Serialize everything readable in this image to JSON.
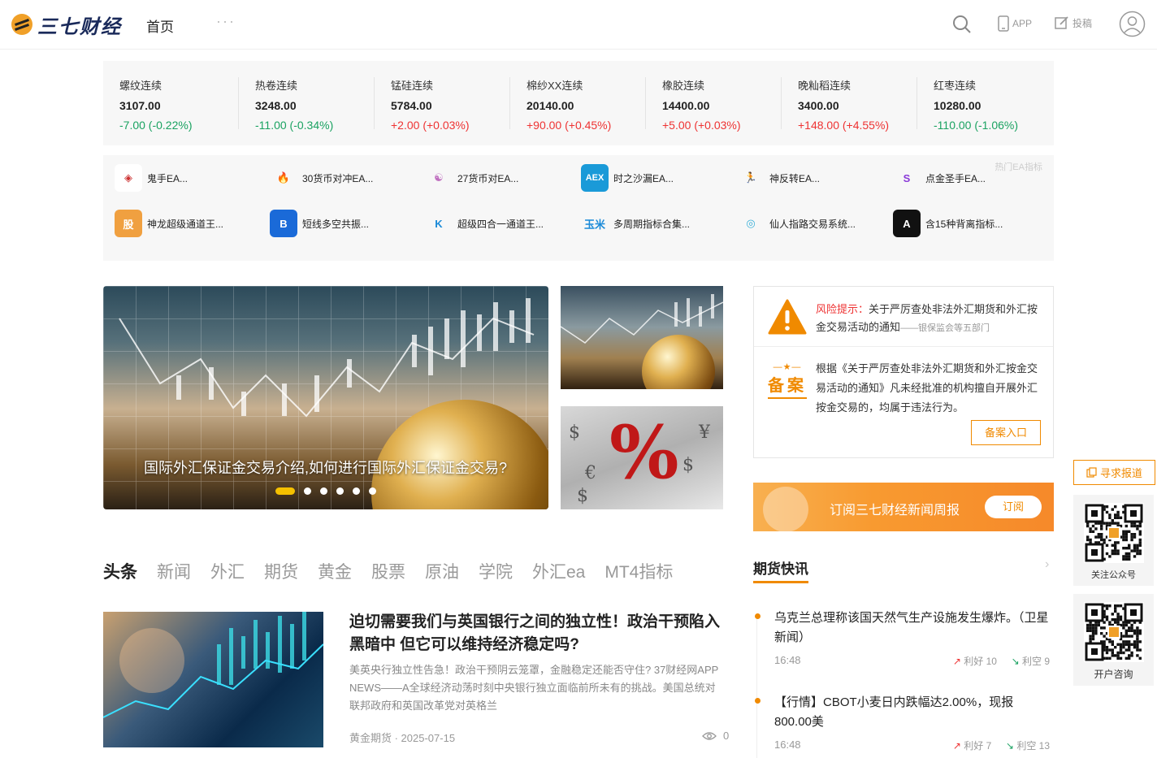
{
  "header": {
    "logo_text": "三七财经",
    "nav_home": "首页",
    "nav_more": "···",
    "app_label": "APP",
    "post_label": "投稿"
  },
  "quotes": [
    {
      "name": "螺纹连续",
      "price": "3107.00",
      "change": "-7.00 (-0.22%)",
      "dir": "down"
    },
    {
      "name": "热卷连续",
      "price": "3248.00",
      "change": "-11.00 (-0.34%)",
      "dir": "down"
    },
    {
      "name": "锰硅连续",
      "price": "5784.00",
      "change": "+2.00 (+0.03%)",
      "dir": "up"
    },
    {
      "name": "棉纱XX连续",
      "price": "20140.00",
      "change": "+90.00 (+0.45%)",
      "dir": "up"
    },
    {
      "name": "橡胶连续",
      "price": "14400.00",
      "change": "+5.00 (+0.03%)",
      "dir": "up"
    },
    {
      "name": "晚籼稻连续",
      "price": "3400.00",
      "change": "+148.00 (+4.55%)",
      "dir": "up"
    },
    {
      "name": "红枣连续",
      "price": "10280.00",
      "change": "-110.00 (-1.06%)",
      "dir": "down"
    }
  ],
  "ea": {
    "hot_label": "热门EA指标",
    "items": [
      {
        "name": "鬼手EA...",
        "icon": "ghost-hand-icon",
        "glyph": "◈",
        "bg": "#ffffff",
        "fg": "#c33"
      },
      {
        "name": "30货币对冲EA...",
        "icon": "flame-drop-icon",
        "glyph": "🔥",
        "bg": "transparent",
        "fg": "#1a5ad8"
      },
      {
        "name": "27货币对EA...",
        "icon": "ribbon-icon",
        "glyph": "☯",
        "bg": "transparent",
        "fg": "#c070c0"
      },
      {
        "name": "时之沙漏EA...",
        "icon": "aex-icon",
        "glyph": "AEX",
        "bg": "#1a9ad8",
        "fg": "#ffffff"
      },
      {
        "name": "神反转EA...",
        "icon": "runner-icon",
        "glyph": "🏃",
        "bg": "transparent",
        "fg": "#222"
      },
      {
        "name": "点金圣手EA...",
        "icon": "cube-s-icon",
        "glyph": "S",
        "bg": "transparent",
        "fg": "#8a3ad8"
      },
      {
        "name": "神龙超级通道王...",
        "icon": "shield-icon",
        "glyph": "股",
        "bg": "#f0a040",
        "fg": "#ffffff"
      },
      {
        "name": "短线多空共振...",
        "icon": "b-logo-icon",
        "glyph": "B",
        "bg": "#1a6ad8",
        "fg": "#ffffff"
      },
      {
        "name": "超级四合一通道王...",
        "icon": "k-logo-icon",
        "glyph": "K",
        "bg": "transparent",
        "fg": "#1a8ad8"
      },
      {
        "name": "多周期指标合集...",
        "icon": "yumi-icon",
        "glyph": "玉米",
        "bg": "transparent",
        "fg": "#1a8ad8"
      },
      {
        "name": "仙人指路交易系统...",
        "icon": "swirl-icon",
        "glyph": "◎",
        "bg": "transparent",
        "fg": "#3ab0d8"
      },
      {
        "name": "含15种背离指标...",
        "icon": "a-logo-icon",
        "glyph": "A",
        "bg": "#111111",
        "fg": "#ffffff"
      }
    ]
  },
  "banner": {
    "caption": "国际外汇保证金交易介绍,如何进行国际外汇保证金交易?",
    "dots": 6,
    "active_dot": 0,
    "thumb2_text": "%"
  },
  "risk": {
    "title_red": "风险提示：",
    "title": "关于严厉查处非法外汇期货和外汇按金交易活动的通知",
    "source": "——银保监会等五部门",
    "beian_stars": "—★—",
    "beian_label": "备案",
    "desc": "根据《关于严厉查处非法外汇期货和外汇按金交易活动的通知》凡未经批准的机构擅自开展外汇按金交易的，均属于违法行为。",
    "button": "备案入口"
  },
  "subscribe": {
    "text": "订阅三七财经新闻周报",
    "button": "订阅"
  },
  "side": {
    "seek": "寻求报道",
    "qr1_caption": "关注公众号",
    "qr2_caption": "开户咨询"
  },
  "tabs": [
    "头条",
    "新闻",
    "外汇",
    "期货",
    "黄金",
    "股票",
    "原油",
    "学院",
    "外汇ea",
    "MT4指标"
  ],
  "article": {
    "title": "迫切需要我们与英国银行之间的独立性！政治干预陷入黑暗中 但它可以维持经济稳定吗?",
    "summary": "美英央行独立性告急！政治干预阴云笼罩，金融稳定还能否守住? 37财经网APP NEWS——A全球经济动荡时刻中央银行独立面临前所未有的挑战。美国总统对联邦政府和英国改革党对英格兰",
    "meta": "黄金期货 · 2025-07-15",
    "views": "0"
  },
  "flash": {
    "title": "期货快讯",
    "arrow": "›",
    "items": [
      {
        "text": "乌克兰总理称该国天然气生产设施发生爆炸。（卫星新闻）",
        "time": "16:48",
        "bull": "利好 10",
        "bear": "利空 9"
      },
      {
        "text": "【行情】CBOT小麦日内跌幅达2.00%，现报800.00美",
        "time": "16:48",
        "bull": "利好 7",
        "bear": "利空 13"
      }
    ]
  },
  "colors": {
    "accent": "#f08a00",
    "up": "#ee3333",
    "down": "#1aa261"
  }
}
